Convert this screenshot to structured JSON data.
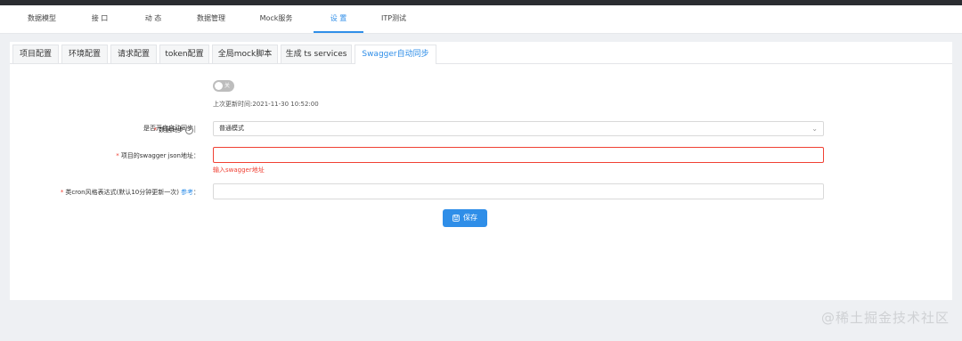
{
  "nav": {
    "items": [
      "数据模型",
      "接 口",
      "动 态",
      "数据管理",
      "Mock服务",
      "设 置",
      "ITP测试"
    ],
    "active_index": 5
  },
  "tabs": {
    "items": [
      "项目配置",
      "环境配置",
      "请求配置",
      "token配置",
      "全局mock脚本",
      "生成 ts services",
      "Swagger自动同步"
    ],
    "active_index": 6
  },
  "form": {
    "auto_sync_label": "是否开启自动同步：",
    "auto_sync_switch_text": "关",
    "last_update": "上次更新时间:2021-11-30 10:52:00",
    "data_sync_label": "数据同步",
    "data_sync_colon": "：",
    "data_sync_value": "普通模式",
    "json_url_label": "项目的swagger json地址：",
    "json_url_value": "",
    "json_url_error": "输入swagger地址",
    "cron_label": "类cron风格表达式(默认10分钟更新一次)",
    "cron_ref": "参考",
    "cron_colon": "：",
    "cron_value": "",
    "save_label": "保存"
  },
  "watermark": "@稀土掘金技术社区",
  "colors": {
    "accent": "#2f8ee8",
    "error": "#f04134"
  }
}
